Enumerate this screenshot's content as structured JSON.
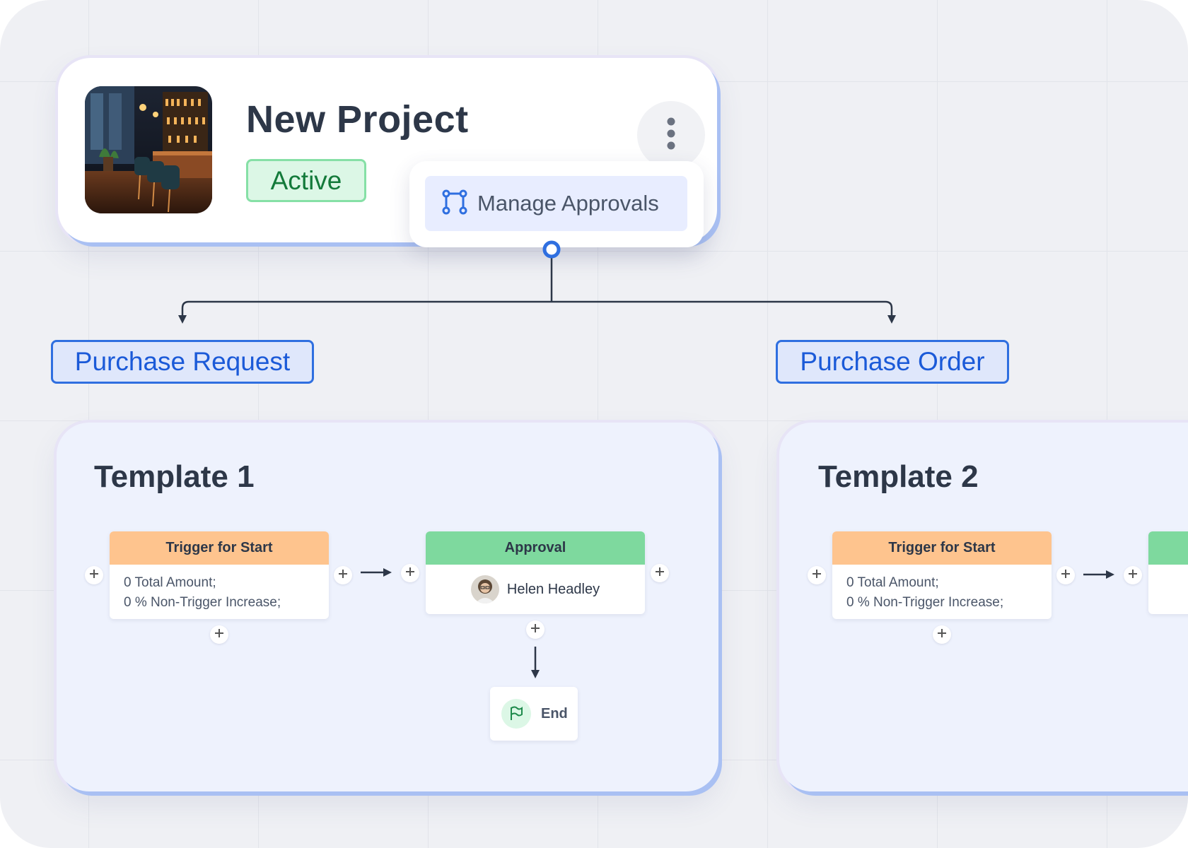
{
  "project": {
    "title": "New Project",
    "status": "Active",
    "menu": {
      "manage_approvals_label": "Manage Approvals"
    }
  },
  "categories": [
    "Purchase Request",
    "Purchase Order"
  ],
  "templates": [
    {
      "title": "Template 1",
      "trigger": {
        "header": "Trigger for Start",
        "line1": "0 Total Amount;",
        "line2": "0 % Non-Trigger Increase;"
      },
      "approval": {
        "header": "Approval",
        "approver": "Helen Headley"
      },
      "end": {
        "label": "End"
      }
    },
    {
      "title": "Template 2",
      "trigger": {
        "header": "Trigger for Start",
        "line1": "0 Total Amount;",
        "line2": "0 % Non-Trigger Increase;"
      }
    }
  ],
  "colors": {
    "accent_blue": "#2f6fe0",
    "status_green": "#137a3a",
    "trigger_orange": "#fec48e",
    "approval_green": "#7ed99e"
  },
  "icons": {
    "menu_button": "more-vertical-icon",
    "manage_approvals": "workflow-icon",
    "end": "flag-icon",
    "add": "plus-icon"
  }
}
